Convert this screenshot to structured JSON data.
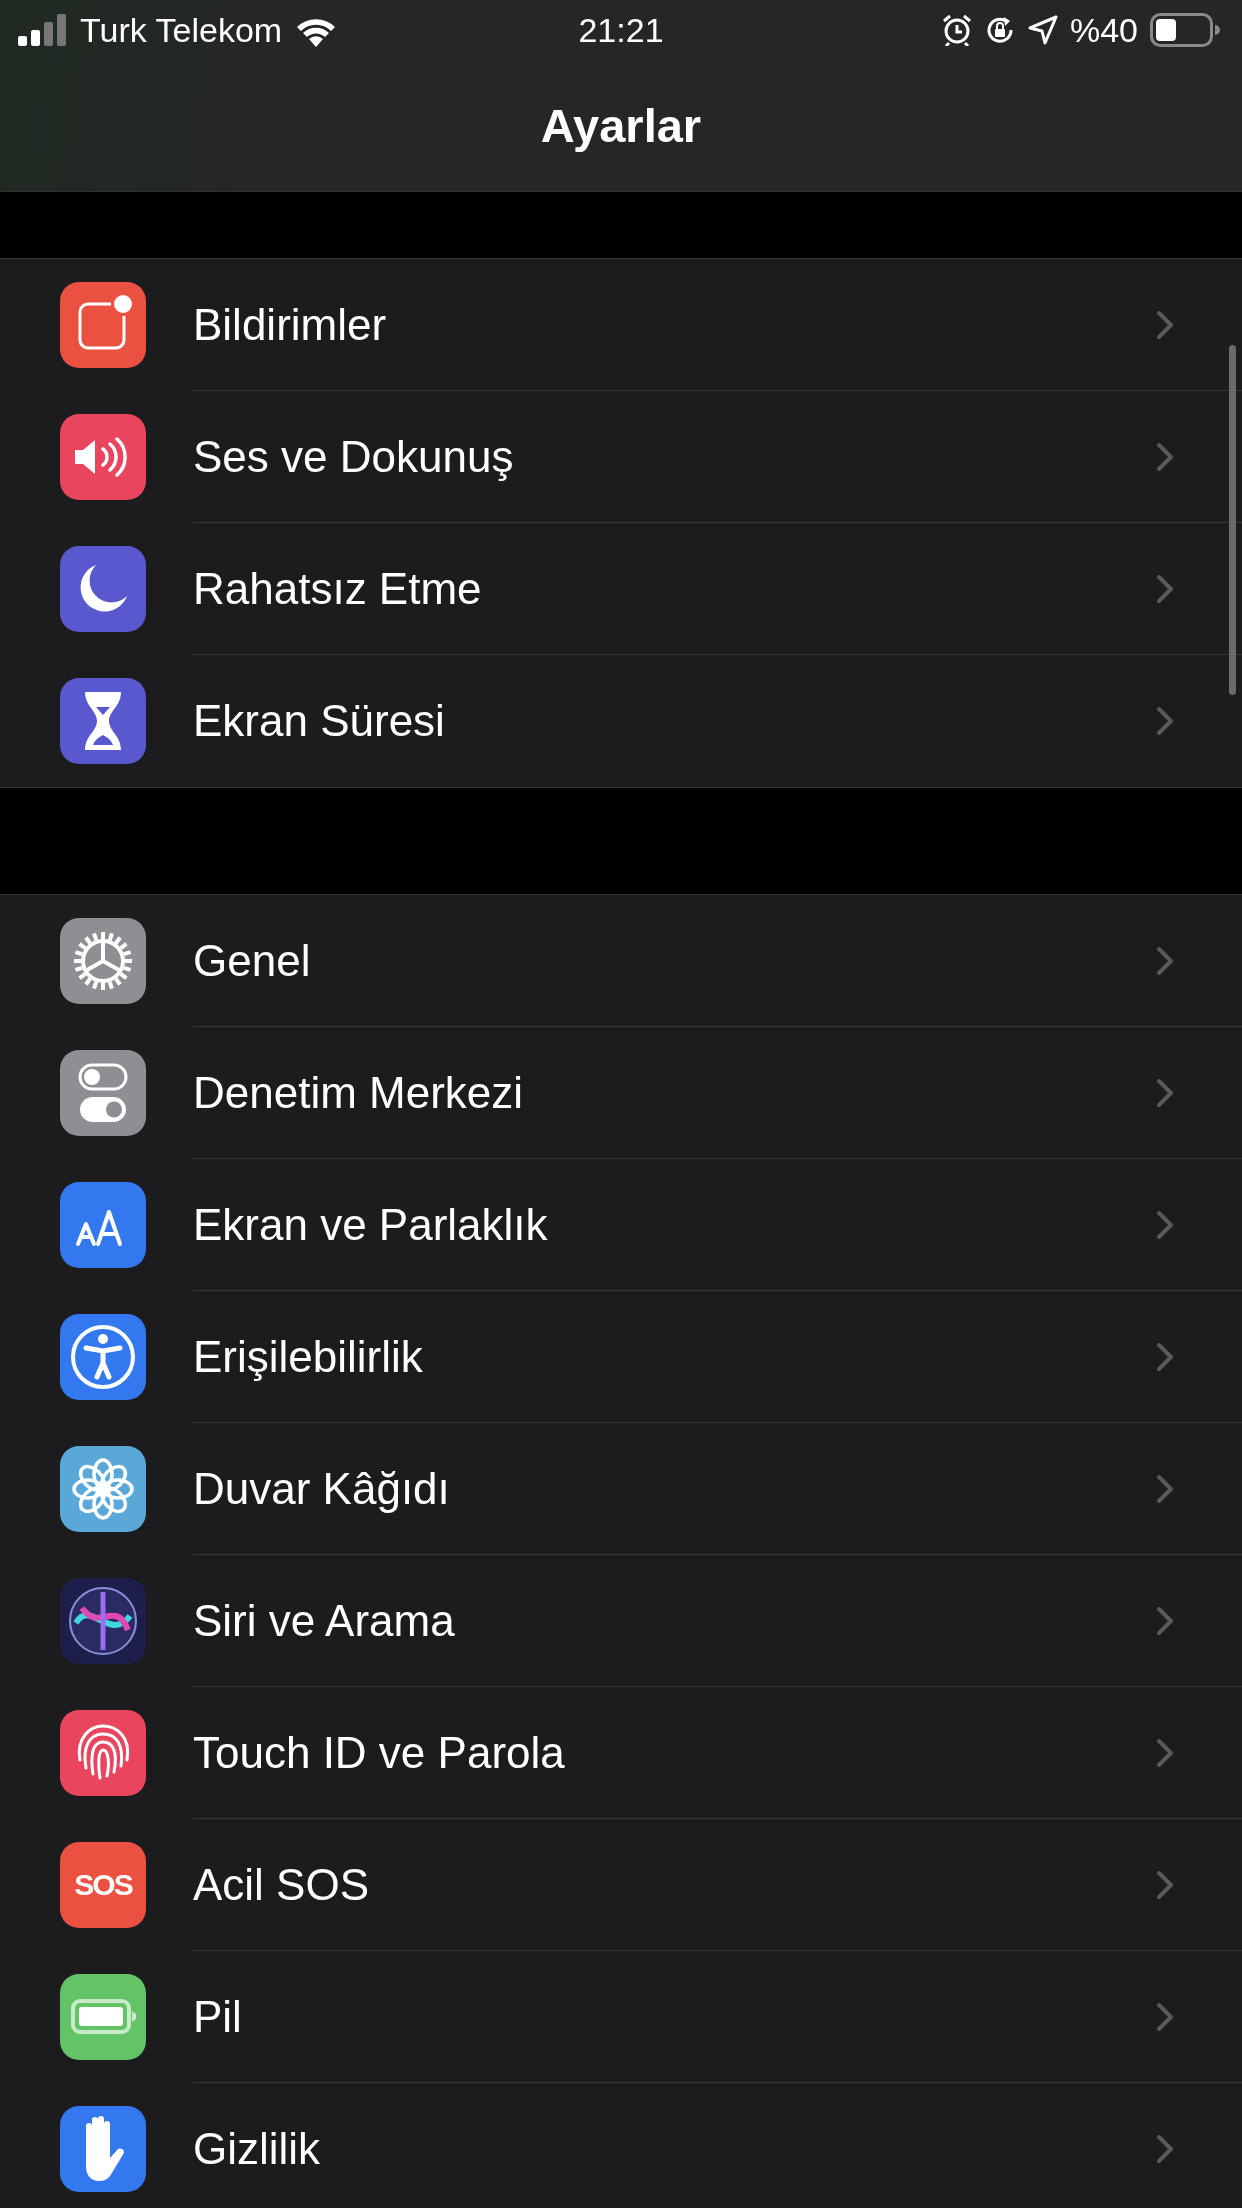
{
  "status_bar": {
    "carrier": "Turk Telekom",
    "time": "21:21",
    "battery": "%40"
  },
  "nav": {
    "title": "Ayarlar"
  },
  "groups": [
    {
      "items": [
        {
          "label": "Bildirimler",
          "kind": "notifications",
          "color": "#eb5141"
        },
        {
          "label": "Ses ve Dokunuş",
          "kind": "sound",
          "color": "#e9455f"
        },
        {
          "label": "Rahatsız Etme",
          "kind": "moon",
          "color": "#5a58cf"
        },
        {
          "label": "Ekran Süresi",
          "kind": "hourglass",
          "color": "#5a58cf"
        }
      ]
    },
    {
      "items": [
        {
          "label": "Genel",
          "kind": "gear",
          "color": "#8e8e93"
        },
        {
          "label": "Denetim Merkezi",
          "kind": "toggles",
          "color": "#8e8e93"
        },
        {
          "label": "Ekran ve Parlaklık",
          "kind": "text-size",
          "color": "#3478f0"
        },
        {
          "label": "Erişilebilirlik",
          "kind": "accessibility",
          "color": "#3478f0"
        },
        {
          "label": "Duvar Kâğıdı",
          "kind": "flower",
          "color": "#5aa8d8"
        },
        {
          "label": "Siri ve Arama",
          "kind": "siri",
          "color": "#1d1f4a"
        },
        {
          "label": "Touch ID ve Parola",
          "kind": "fingerprint",
          "color": "#e9455f"
        },
        {
          "label": "Acil SOS",
          "kind": "sos",
          "color": "#eb5141",
          "icon_text": "SOS"
        },
        {
          "label": "Pil",
          "kind": "battery",
          "color": "#62c466"
        },
        {
          "label": "Gizlilik",
          "kind": "hand",
          "color": "#3478f0"
        }
      ]
    }
  ]
}
